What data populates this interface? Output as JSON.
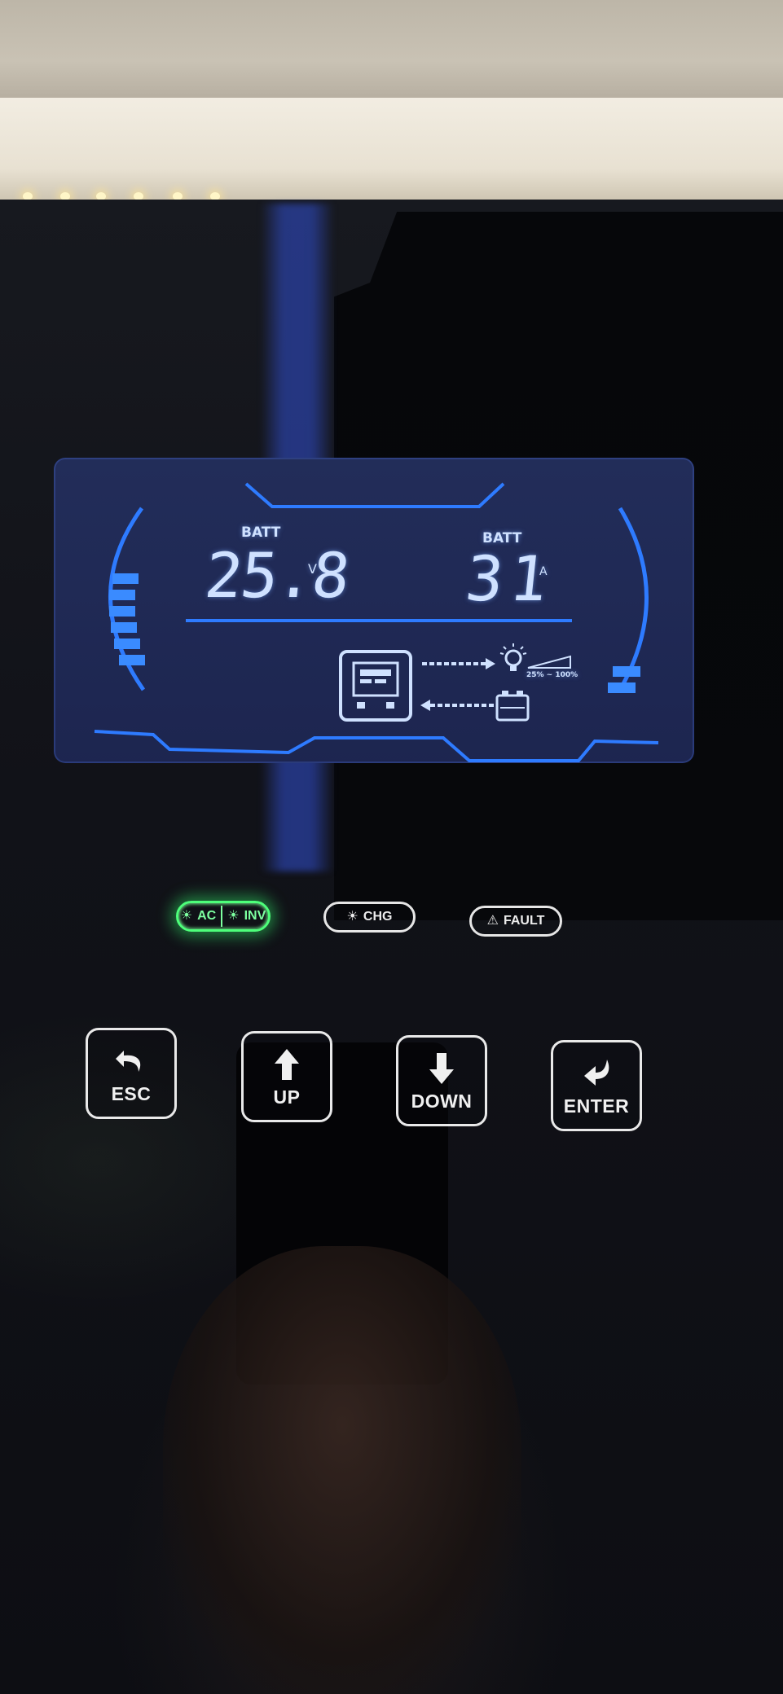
{
  "display": {
    "left_label": "BATT",
    "voltage_value": "25.8",
    "voltage_unit": "V",
    "right_label": "BATT",
    "current_value": "31",
    "current_unit": "A",
    "load_percent_label": "25% ~ 100%",
    "battery_level_segments": 6,
    "load_level_segments": 2,
    "icons": [
      "battery-bar-left",
      "inverter-meter-icon",
      "flow-arrow-right",
      "flow-arrow-left",
      "bulb-icon",
      "load-ramp-icon",
      "battery-icon"
    ],
    "accent_color": "#2e7bff"
  },
  "indicators": {
    "ac_label": "AC",
    "inv_label": "INV",
    "chg_label": "CHG",
    "fault_label": "FAULT",
    "ac_inv_state": "on",
    "ac_inv_color": "#4dff7a"
  },
  "buttons": {
    "esc": "ESC",
    "up": "UP",
    "down": "DOWN",
    "enter": "ENTER"
  }
}
